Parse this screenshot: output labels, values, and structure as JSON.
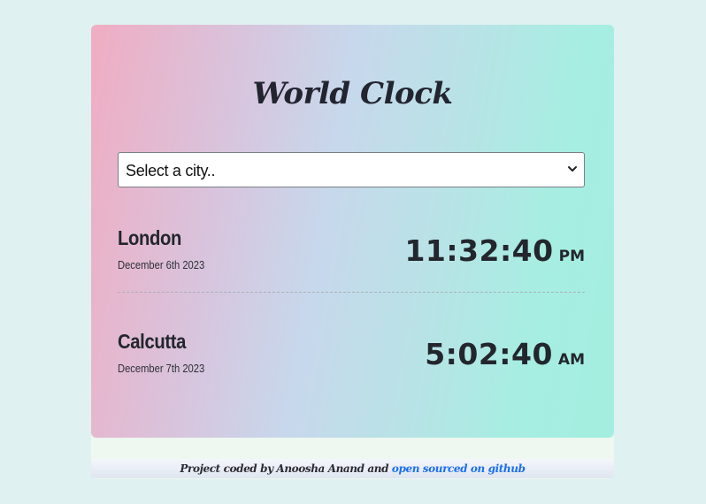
{
  "app": {
    "title": "World Clock"
  },
  "select": {
    "value": "Select a city.."
  },
  "cities": [
    {
      "name": "London",
      "date": "December 6th 2023",
      "time": "11:32:40",
      "ampm": "PM"
    },
    {
      "name": "Calcutta",
      "date": "December 7th 2023",
      "time": "5:02:40",
      "ampm": "AM"
    }
  ],
  "footer": {
    "text": "Project coded by Anoosha Anand and ",
    "link_text": "open sourced on github"
  },
  "colors": {
    "page_background": "#dff1f0",
    "gradient_start": "#f0adc2",
    "gradient_end": "#a3eee0",
    "link": "#1b6ff0",
    "text": "#23262d"
  },
  "icons": {
    "select_arrow": "chevron-down-icon"
  }
}
